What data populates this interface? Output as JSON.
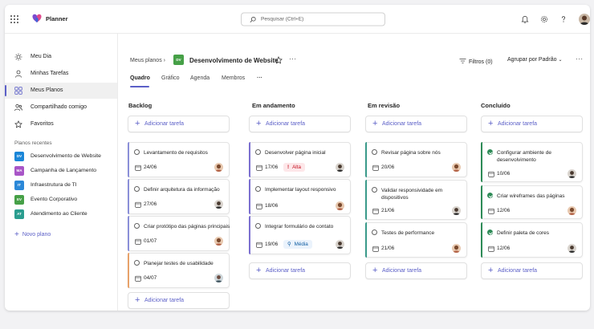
{
  "app": {
    "name": "Planner"
  },
  "search": {
    "placeholder": "Pesquisar (Ctrl+E)"
  },
  "topbar_icons": [
    "bell-icon",
    "gear-icon",
    "help-icon"
  ],
  "sidebar": {
    "nav": [
      {
        "label": "Meu Dia",
        "icon": "sun-icon"
      },
      {
        "label": "Minhas Tarefas",
        "icon": "person-icon"
      },
      {
        "label": "Meus Planos",
        "icon": "grid-icon",
        "active": true
      },
      {
        "label": "Compartilhado comigo",
        "icon": "people-icon"
      },
      {
        "label": "Favoritos",
        "icon": "star-icon"
      }
    ],
    "recent_heading": "Planos recentes",
    "recent": [
      {
        "badge": "DV",
        "label": "Desenvolvimento de Website",
        "color": "#1a86d8"
      },
      {
        "badge": "MA",
        "label": "Campanha de Lançamento",
        "color": "#a855c7"
      },
      {
        "badge": "IT",
        "label": "Infraestrutura de TI",
        "color": "#2b88d8"
      },
      {
        "badge": "EV",
        "label": "Evento Corporativo",
        "color": "#46a047"
      },
      {
        "badge": "AT",
        "label": "Atendimento ao Cliente",
        "color": "#2a9d8f"
      }
    ],
    "new_plan": "Novo plano"
  },
  "header": {
    "breadcrumb": "Meus planos",
    "plan_badge": "DV",
    "plan_title": "Desenvolvimento de Website",
    "more": "···",
    "filters": "Filtros (0)",
    "group": "Agrupar por Padrão",
    "tabs": [
      "Quadro",
      "Gráfico",
      "Agenda",
      "Membros"
    ],
    "tabs_more": "···"
  },
  "board": {
    "add_label": "Adicionar tarefa",
    "columns": [
      {
        "title": "Backlog",
        "cards": [
          {
            "title": "Levantamento de requisitos",
            "date": "24/06"
          },
          {
            "title": "Definir arquitetura da informação",
            "date": "27/06"
          },
          {
            "title": "Criar protótipo das páginas principais",
            "date": "01/07"
          },
          {
            "title": "Planejar testes de usabilidade",
            "date": "04/07"
          }
        ]
      },
      {
        "title": "Em andamento",
        "cards": [
          {
            "title": "Desenvolver página inicial",
            "date": "17/06",
            "priority": "Alta"
          },
          {
            "title": "Implementar layout responsivo",
            "date": "18/06"
          },
          {
            "title": "Integrar formulário de contato",
            "date": "19/06",
            "priority": "Média"
          }
        ]
      },
      {
        "title": "Em revisão",
        "cards": [
          {
            "title": "Revisar página sobre nós",
            "date": "20/06"
          },
          {
            "title": "Validar responsividade em dispositivos",
            "date": "21/06"
          },
          {
            "title": "Testes de performance",
            "date": "21/06"
          }
        ]
      },
      {
        "title": "Concluído",
        "cards": [
          {
            "title": "Configurar ambiente de desenvolvimento",
            "date": "10/06",
            "done": true
          },
          {
            "title": "Criar wireframes das páginas",
            "date": "12/06",
            "done": true
          },
          {
            "title": "Definir paleta de cores",
            "date": "12/06",
            "done": true
          }
        ]
      }
    ]
  },
  "colors": {
    "accent": "#5b5fc7",
    "backlog": "#8b8fd8",
    "in_progress": "#7b6fd0",
    "review": "#3a9a8a",
    "done": "#2e8b57"
  }
}
